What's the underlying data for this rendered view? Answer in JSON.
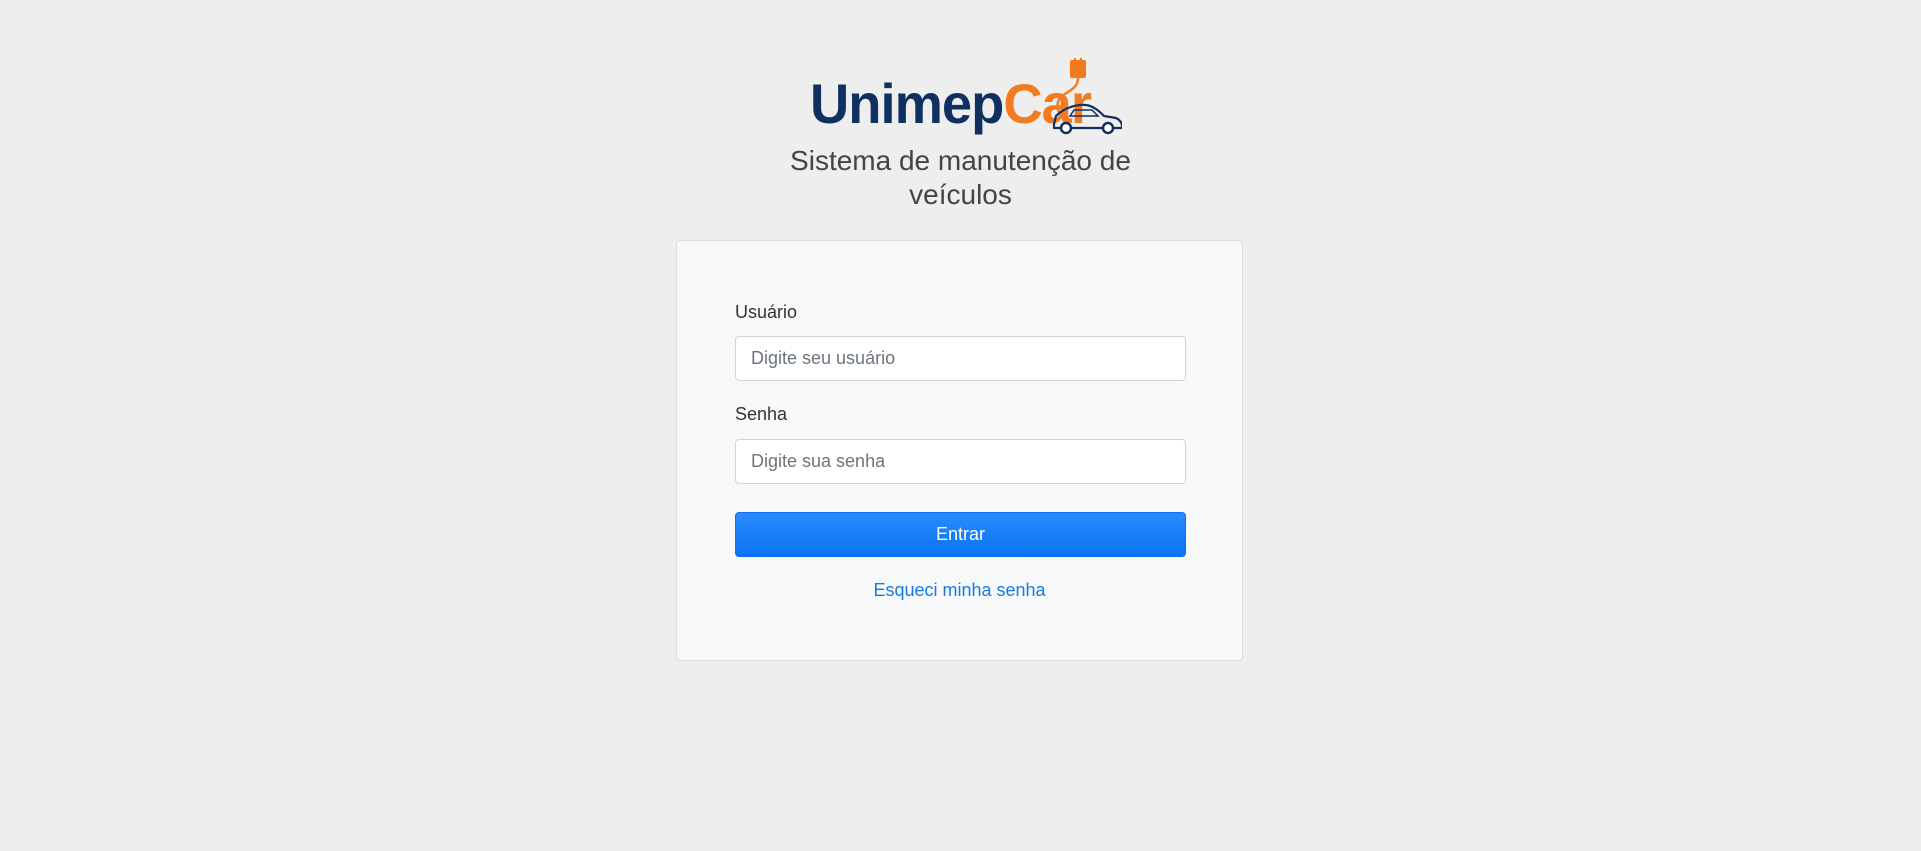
{
  "brand": {
    "logo_part1": "Unimep",
    "logo_part2": "Car",
    "logo_icon": "car-with-plug-icon",
    "colors": {
      "navy": "#10305f",
      "orange": "#f47a20"
    }
  },
  "header": {
    "subtitle": "Sistema de manutenção de veículos"
  },
  "login_form": {
    "username_label": "Usuário",
    "username_placeholder": "Digite seu usuário",
    "username_value": "",
    "password_label": "Senha",
    "password_placeholder": "Digite sua senha",
    "password_value": "",
    "submit_label": "Entrar",
    "forgot_password_label": "Esqueci minha senha"
  },
  "theme": {
    "background": "#eeeeee",
    "card_background": "#f7f8fa",
    "primary": "#0d6efd",
    "link": "#1a7ae0"
  }
}
